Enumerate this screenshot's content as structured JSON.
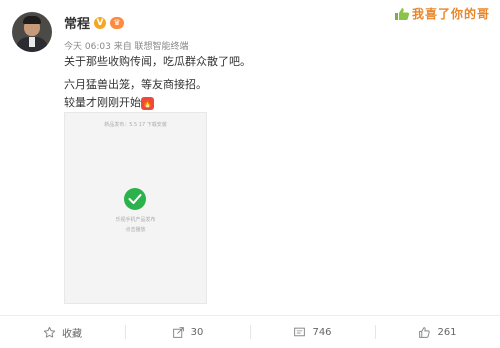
{
  "post": {
    "author": "常程",
    "verified_badge": "V",
    "level_badge": "♛",
    "timestamp": "今天 06:03",
    "source": "来自 联想智能终端",
    "lines": [
      "关于那些收购传闻，吃瓜群众散了吧。",
      "六月猛兽出笼，等友商接招。",
      "较量才刚刚开始"
    ],
    "fire_emoji": "🔥"
  },
  "banner": {
    "text": "我喜了你的哥",
    "icon": "thumb-up-icon"
  },
  "image": {
    "header_text": "新品发布：5.5 17 下载安装",
    "caption1": "乐视手机产品发布",
    "caption2": "点击播放"
  },
  "actions": {
    "favorite_label": "收藏",
    "repost_count": "30",
    "comment_count": "746",
    "like_count": "261"
  },
  "colors": {
    "accent_green": "#2bb24c",
    "badge_orange": "#f5a623",
    "banner_orange": "#e8862a",
    "fire_red": "#ec4a3c"
  }
}
